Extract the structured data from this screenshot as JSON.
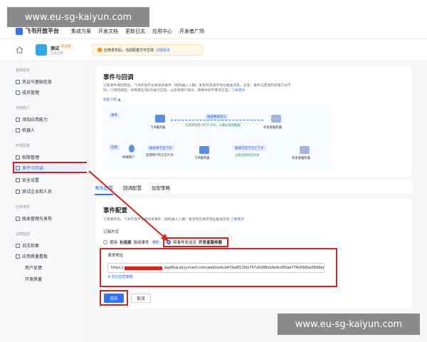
{
  "watermark": "www.eu-sg-kaiyun.com",
  "topnav": {
    "brand": "飞书开放平台",
    "links": [
      "集成方案",
      "开发文档",
      "更新日志",
      "应用中心",
      "开发者广场"
    ]
  },
  "appbar": {
    "app_name": "测试",
    "app_tag": "商业版",
    "app_sub": "正式应用",
    "notice": "应用发布后，当前配置方可生效",
    "notice_link": "创建版本"
  },
  "sidebar": {
    "sec_basic": "基础信息",
    "credentials": "凭证与基础信息",
    "members": "成员管理",
    "sec_ability": "应用能力",
    "add_ability": "添加应用能力",
    "bot": "机器人",
    "sec_dev": "开发配置",
    "permissions": "权限管理",
    "events": "事件与回调",
    "security": "安全设置",
    "test_enterprise": "测试企业和人员",
    "sec_publish": "应用发布",
    "versions": "版本管理与发布",
    "sec_ops": "运营监控",
    "logs": "日志检索",
    "quality": "应用质量看板",
    "user_feedback": "用户反馈",
    "dev_quality": "开发质量"
  },
  "card1": {
    "title": "事件与回调",
    "desc_line1": "订阅事件或回调后，飞书开放平台将会将事件（如机器人入群）发生时向请求地址推送消息。注意：事件与回调的处理方式不",
    "desc_line2": "同，订阅回调后，你需要在3秒内进行应答，以反馈用户操作，而事件则不要求应答。",
    "desc_link": "了解更多",
    "collapse": "收起介绍 ▲"
  },
  "diagram": {
    "events_label": "事件",
    "callbacks_label": "回调",
    "feishu_server_1": "飞书服务器",
    "dev_server_1": "开发者服务器",
    "push_data": "推送数据变化",
    "http_reply": "可选择返回 HTTP 200，以确认收到数据",
    "end_user": "终端用户",
    "trigger_action": "触发将交互行为",
    "feedback_action": "反馈用户的交互行为",
    "feishu_server_2": "飞书服务器",
    "push_action": "推送交互行为上下文",
    "reply_3s": "立即返回响应内容",
    "dev_server_2": "开发者服务器"
  },
  "tabs": [
    "事件配置",
    "回调配置",
    "加密策略"
  ],
  "card2": {
    "title": "事件配置",
    "desc": "订阅事件后，飞书开放平台将会将事件（如机器人入群）发生时向请求地址推送消息",
    "desc_link": "了解更多",
    "sub_method": "订阅方式",
    "opt1_prefix": "使用",
    "opt1_bold": "长连接",
    "opt1_suffix": "接收事件",
    "opt1_tag": "推荐",
    "opt2_prefix": "将事件发送至",
    "opt2_bold": "开发者服务器",
    "url_label": "请求地址",
    "url_prefix": "https://",
    "url_suffix": ".appflow.aliyunnest.com/webhook/a479a8f12fdc747a5d98cb0e9cd93ae774a566ba58d9ai",
    "encrypt_link": "前往加密策略",
    "save": "保存",
    "cancel": "取消"
  },
  "colors": {
    "accent": "#3370ff",
    "highlight_red": "#d9221c",
    "watermark_bg": "#8a8a8a"
  }
}
